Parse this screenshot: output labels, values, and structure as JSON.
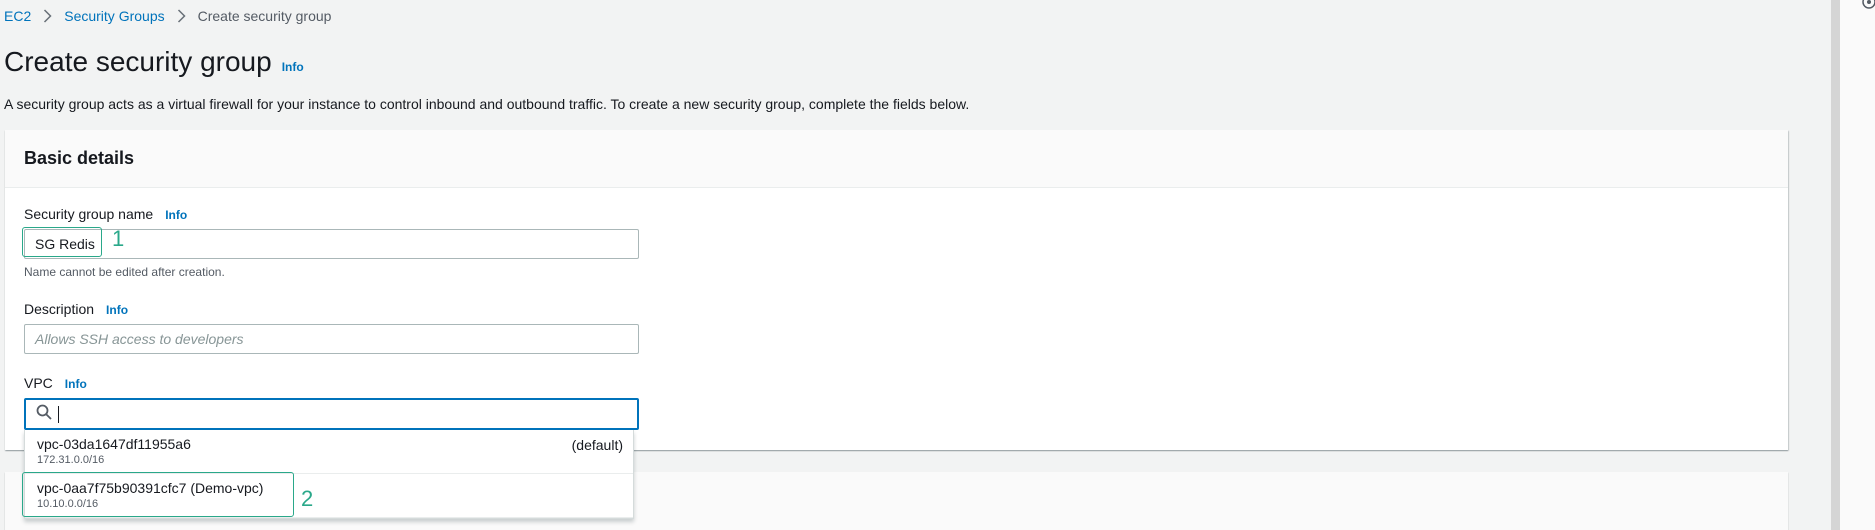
{
  "breadcrumb": {
    "items": [
      "EC2",
      "Security Groups"
    ],
    "current": "Create security group"
  },
  "page": {
    "title": "Create security group",
    "info": "Info",
    "description": "A security group acts as a virtual firewall for your instance to control inbound and outbound traffic. To create a new security group, complete the fields below."
  },
  "basic_details": {
    "title": "Basic details",
    "name_field": {
      "label": "Security group name",
      "info": "Info",
      "value": "SG Redis",
      "hint": "Name cannot be edited after creation."
    },
    "description_field": {
      "label": "Description",
      "info": "Info",
      "placeholder": "Allows SSH access to developers"
    },
    "vpc_field": {
      "label": "VPC",
      "info": "Info",
      "options": [
        {
          "id": "vpc-03da1647df11955a6",
          "cidr": "172.31.0.0/16",
          "tag": "(default)"
        },
        {
          "id": "vpc-0aa7f75b90391cfc7 (Demo-vpc)",
          "cidr": "10.10.0.0/16",
          "tag": ""
        }
      ]
    }
  },
  "annotations": {
    "marker_1": "1",
    "marker_2": "2",
    "color": "#2aa88a"
  },
  "colors": {
    "link": "#0073bb",
    "background": "#f2f3f3",
    "focus": "#0073bb"
  }
}
